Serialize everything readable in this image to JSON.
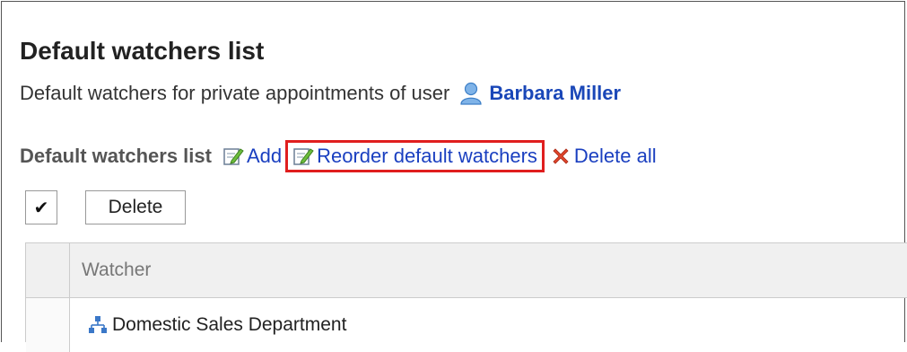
{
  "page": {
    "title": "Default watchers list",
    "subtitle_prefix": "Default watchers for private appointments of user",
    "user_name": "Barbara Miller"
  },
  "toolbar": {
    "label": "Default watchers list",
    "add_label": "Add",
    "reorder_label": "Reorder default watchers",
    "delete_all_label": "Delete all",
    "highlight_color": "#e01e1e",
    "link_color": "#1a3fc0"
  },
  "actions": {
    "check_all_glyph": "✔",
    "delete_label": "Delete"
  },
  "table": {
    "header": "Watcher",
    "rows": [
      {
        "name": "Domestic Sales Department",
        "icon": "organization-icon"
      }
    ]
  }
}
